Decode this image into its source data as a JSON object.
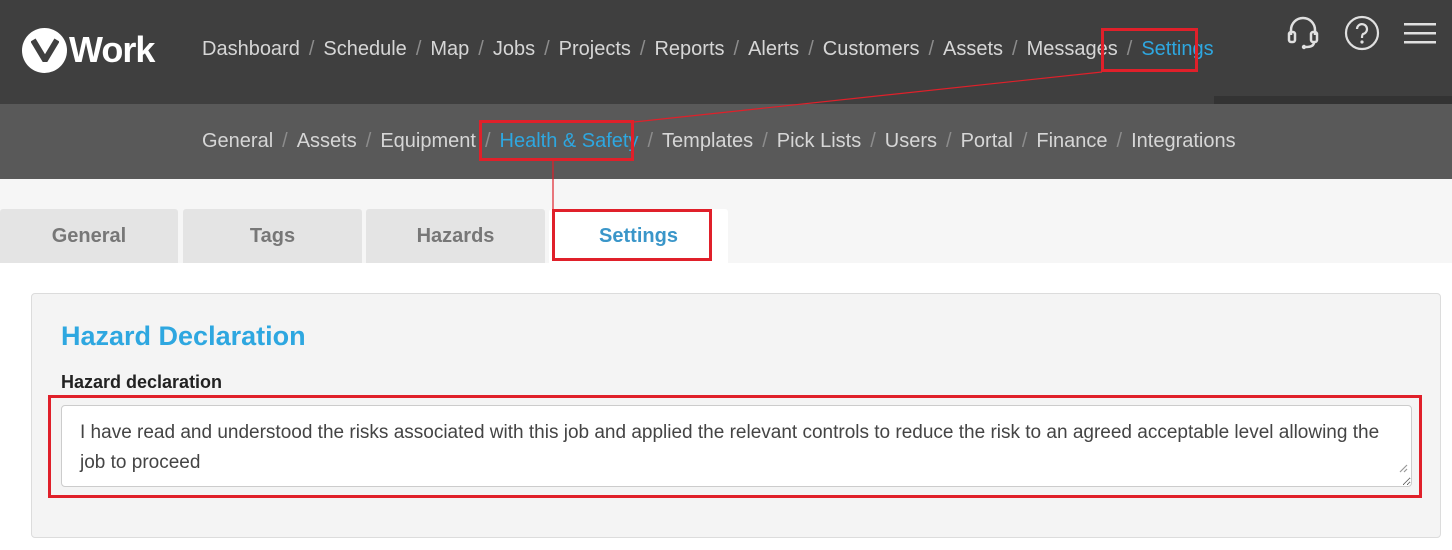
{
  "app": {
    "logo_text": "Work"
  },
  "top_nav": [
    {
      "label": "Dashboard",
      "active": false
    },
    {
      "label": "Schedule",
      "active": false
    },
    {
      "label": "Map",
      "active": false
    },
    {
      "label": "Jobs",
      "active": false
    },
    {
      "label": "Projects",
      "active": false
    },
    {
      "label": "Reports",
      "active": false
    },
    {
      "label": "Alerts",
      "active": false
    },
    {
      "label": "Customers",
      "active": false
    },
    {
      "label": "Assets",
      "active": false
    },
    {
      "label": "Messages",
      "active": false
    },
    {
      "label": "Settings",
      "active": true
    }
  ],
  "top_icons": [
    "headset-icon",
    "help-icon",
    "menu-icon"
  ],
  "sub_nav": [
    {
      "label": "General",
      "active": false
    },
    {
      "label": "Assets",
      "active": false
    },
    {
      "label": "Equipment",
      "active": false
    },
    {
      "label": "Health & Safety",
      "active": true
    },
    {
      "label": "Templates",
      "active": false
    },
    {
      "label": "Pick Lists",
      "active": false
    },
    {
      "label": "Users",
      "active": false
    },
    {
      "label": "Portal",
      "active": false
    },
    {
      "label": "Finance",
      "active": false
    },
    {
      "label": "Integrations",
      "active": false
    }
  ],
  "tabs": [
    {
      "label": "General",
      "active": false
    },
    {
      "label": "Tags",
      "active": false
    },
    {
      "label": "Hazards",
      "active": false
    },
    {
      "label": "Settings",
      "active": true
    }
  ],
  "panel": {
    "title": "Hazard Declaration",
    "field_label": "Hazard declaration",
    "field_value": "I have read and understood the risks associated with this job and applied the relevant controls to reduce the risk to an agreed acceptable level allowing the job to proceed"
  },
  "colors": {
    "accent": "#2ea7e0",
    "highlight": "#e0202a",
    "topbar": "#3f3f3f",
    "subbar": "#595959"
  }
}
